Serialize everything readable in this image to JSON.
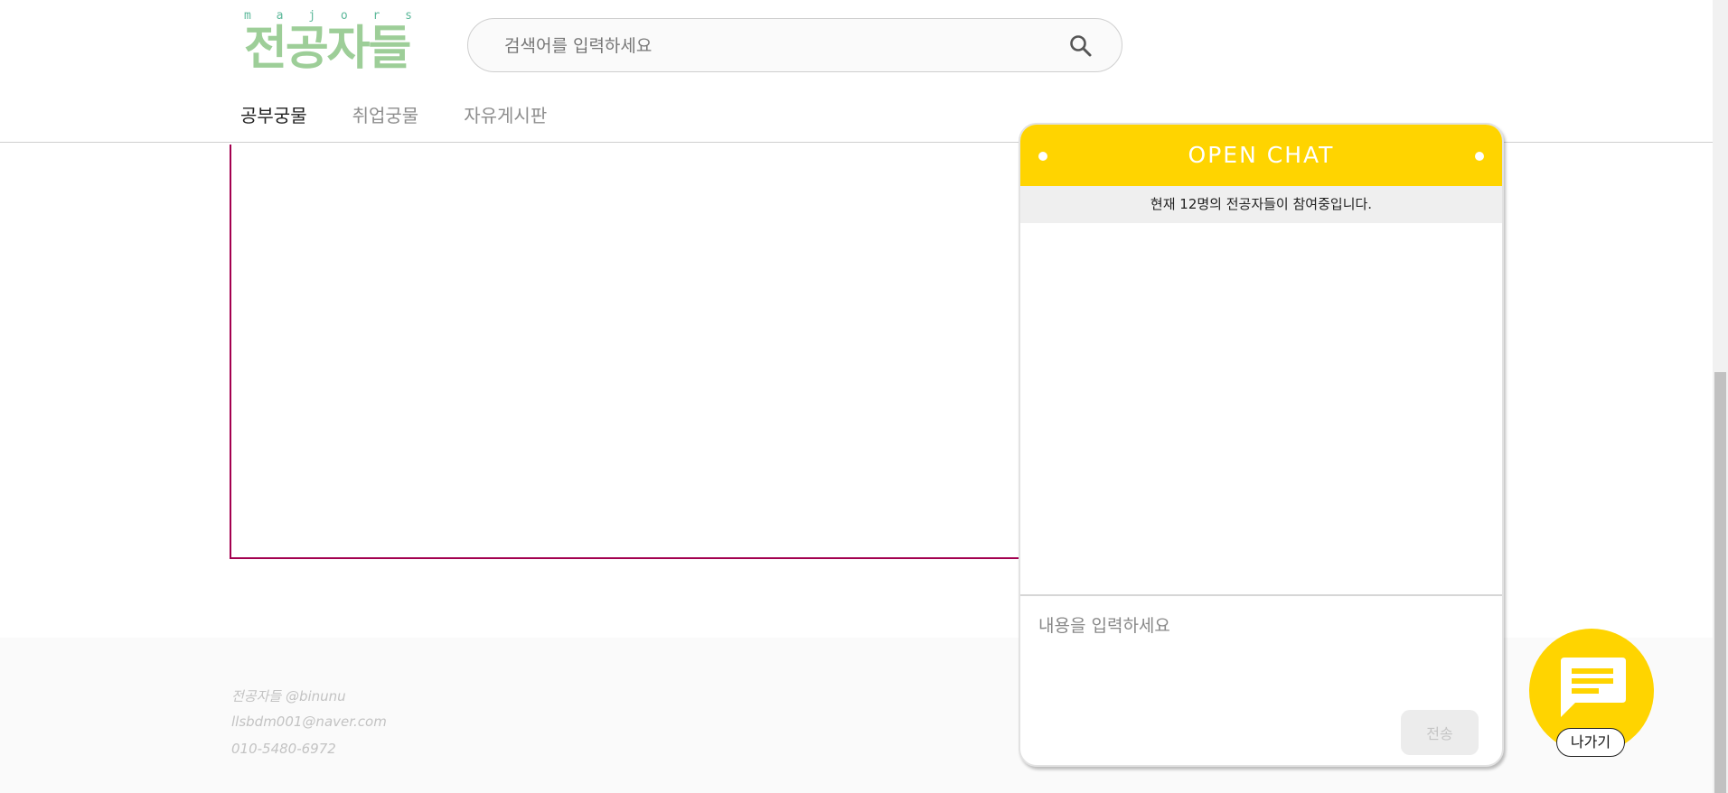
{
  "logo": {
    "tagline_letters": [
      "m",
      "a",
      "j",
      "o",
      "r",
      "s"
    ],
    "name": "전공자들"
  },
  "search": {
    "placeholder": "검색어를 입력하세요",
    "value": "",
    "icon": "search-icon"
  },
  "nav": {
    "items": [
      {
        "label": "공부궁물",
        "active": true
      },
      {
        "label": "취업궁물",
        "active": false
      },
      {
        "label": "자유게시판",
        "active": false
      }
    ]
  },
  "chat": {
    "title": "OPEN CHAT",
    "status": "현재 12명의 전공자들이 참여중입니다.",
    "input_placeholder": "내용을 입력하세요",
    "input_value": "",
    "send_label": "전송",
    "accent_color": "#ffd400"
  },
  "floating": {
    "icon": "chat-bubble-icon",
    "exit_label": "나가기"
  },
  "footer": {
    "lines": [
      "전공자들 @binunu",
      "llsbdm001@naver.com",
      "010-5480-6972"
    ]
  },
  "colors": {
    "brand_green": "#9dce98",
    "content_border": "#a3004f"
  }
}
